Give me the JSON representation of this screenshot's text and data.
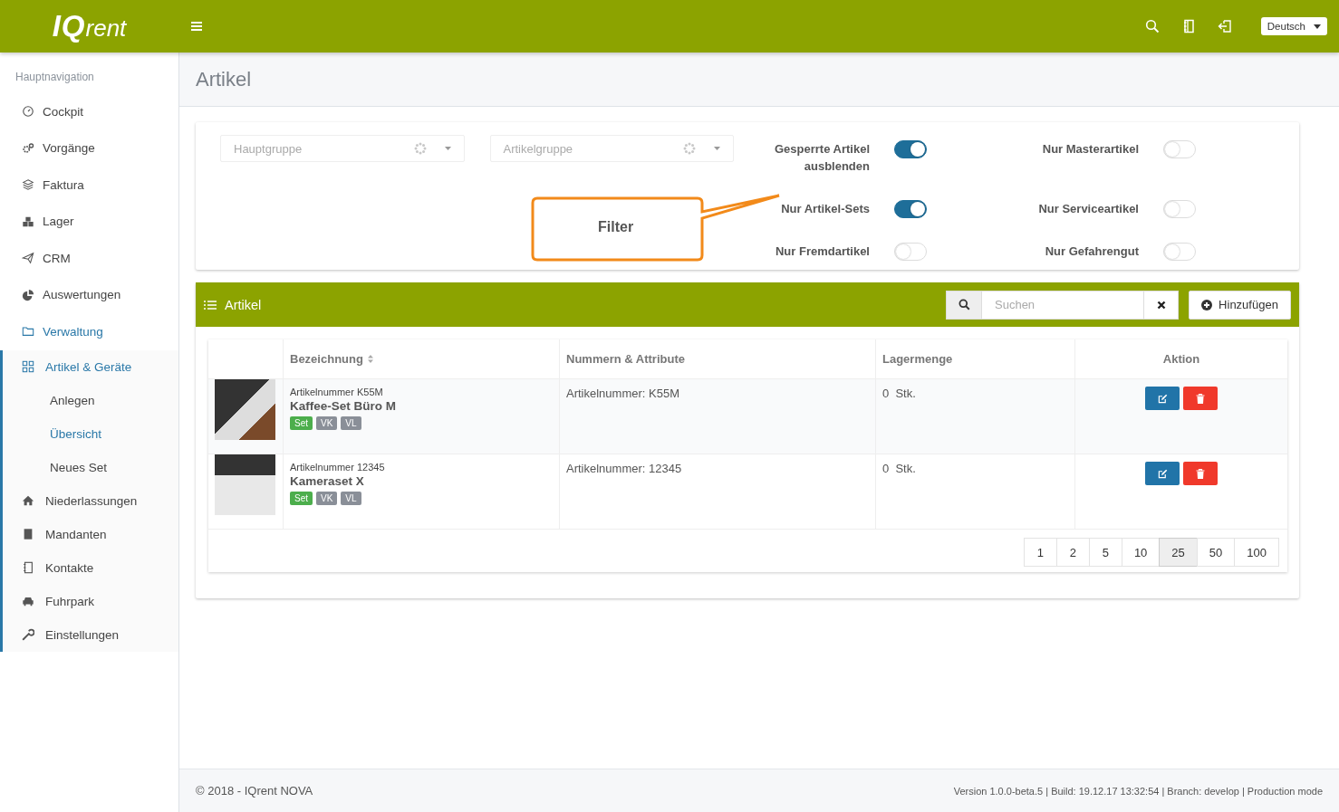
{
  "header": {
    "logo": "**IQ**rent",
    "language": "Deutsch"
  },
  "sidebar": {
    "heading": "Hauptnavigation",
    "items": [
      {
        "label": "Cockpit",
        "selected": false
      },
      {
        "label": "Vorgänge",
        "selected": false
      },
      {
        "label": "Faktura",
        "selected": false
      },
      {
        "label": "Lager",
        "selected": false
      },
      {
        "label": "CRM",
        "selected": false
      },
      {
        "label": "Auswertungen",
        "selected": false
      },
      {
        "label": "Verwaltung",
        "selected": true,
        "expanded": true,
        "children": [
          {
            "label": "Artikel & Geräte",
            "selected": true,
            "expanded": true,
            "children": [
              {
                "label": "Anlegen",
                "selected": false
              },
              {
                "label": "Übersicht",
                "selected": true
              },
              {
                "label": "Neues Set",
                "selected": false
              }
            ]
          },
          {
            "label": "Niederlassungen",
            "selected": false
          },
          {
            "label": "Mandanten",
            "selected": false
          },
          {
            "label": "Kontakte",
            "selected": false
          },
          {
            "label": "Fuhrpark",
            "selected": false
          },
          {
            "label": "Einstellungen",
            "selected": false
          }
        ]
      }
    ]
  },
  "page_title": "Artikel",
  "filters": {
    "selects": [
      {
        "placeholder": "Hauptgruppe"
      },
      {
        "placeholder": "Artikelgruppe"
      }
    ],
    "toggles": [
      {
        "label": "Gesperrte Artikel ausblenden",
        "on": true
      },
      {
        "label": "Nur Masterartikel",
        "on": false
      },
      {
        "label": "Nur Artikel-Sets",
        "on": true
      },
      {
        "label": "Nur Serviceartikel",
        "on": false
      },
      {
        "label": "Nur Fremdartikel",
        "on": false
      },
      {
        "label": "Nur Gefahrengut",
        "on": false
      }
    ],
    "callout": "Filter"
  },
  "articles": {
    "title": "Artikel",
    "search_placeholder": "Suchen",
    "add_button": "Hinzufügen",
    "columns": [
      {
        "label": "Bezeichnung",
        "sortable": true
      },
      {
        "label": "Nummern & Attribute",
        "sortable": false
      },
      {
        "label": "Lagermenge",
        "sortable": false
      },
      {
        "label": "Aktion",
        "sortable": false
      }
    ],
    "rows": [
      {
        "number_label": "Artikelnummer K55M",
        "name": "Kaffee-Set Büro M",
        "tags": [
          {
            "label": "Set",
            "kind": "set"
          },
          {
            "label": "VK",
            "kind": "plain"
          },
          {
            "label": "VL",
            "kind": "plain"
          }
        ],
        "attributes": "Artikelnummer: K55M",
        "stock": "0  Stk."
      },
      {
        "number_label": "Artikelnummer 12345",
        "name": "Kameraset X",
        "tags": [
          {
            "label": "Set",
            "kind": "set"
          },
          {
            "label": "VK",
            "kind": "plain"
          },
          {
            "label": "VL",
            "kind": "plain"
          }
        ],
        "attributes": "Artikelnummer: 12345",
        "stock": "0  Stk."
      }
    ],
    "page_sizes": [
      {
        "label": "1",
        "selected": false
      },
      {
        "label": "2",
        "selected": false
      },
      {
        "label": "5",
        "selected": false
      },
      {
        "label": "10",
        "selected": false
      },
      {
        "label": "25",
        "selected": true
      },
      {
        "label": "50",
        "selected": false
      },
      {
        "label": "100",
        "selected": false
      }
    ]
  },
  "footer": {
    "copyright": "© 2018 - IQrent NOVA",
    "version": "Version 1.0.0-beta.5 | Build: 19.12.17 13:32:54 | Branch: develop | Production mode"
  }
}
